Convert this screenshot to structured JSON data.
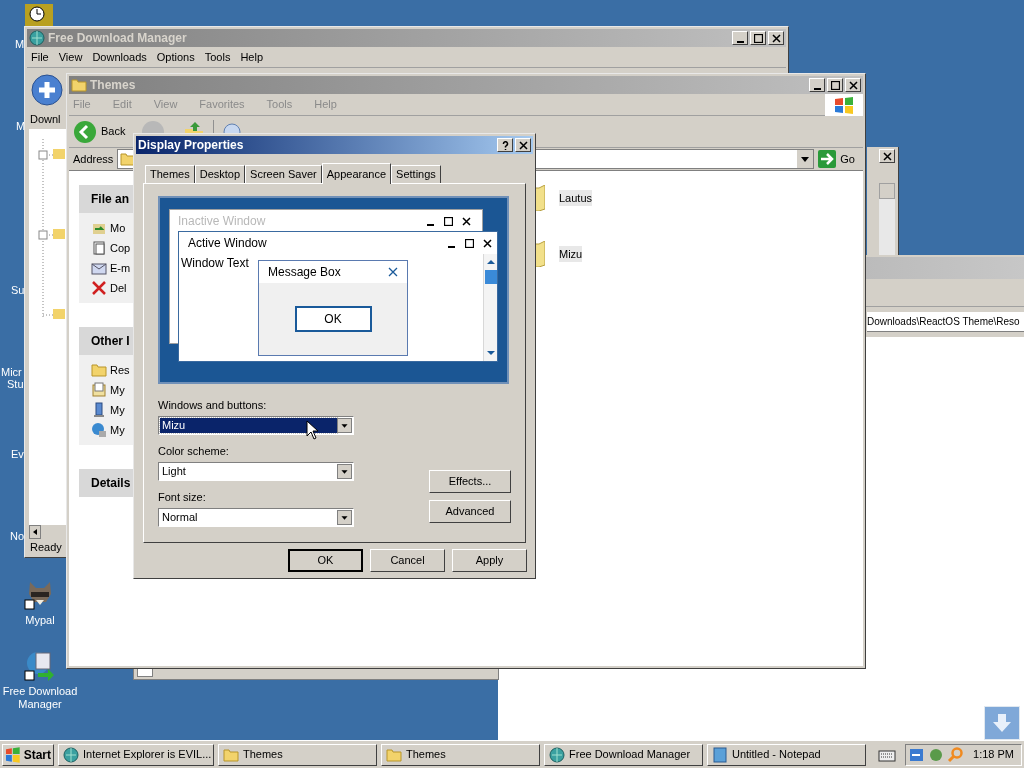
{
  "desktop": {
    "cut_labels": [
      "M",
      "M",
      "Su",
      "Micr",
      "Stu",
      "Ev",
      "No"
    ],
    "icons": [
      {
        "label": "Mypal",
        "kind": "raccoon"
      },
      {
        "label": "Free Download Manager",
        "kind": "download"
      }
    ]
  },
  "fdm_window": {
    "title": "Free Download Manager",
    "menu": [
      "File",
      "View",
      "Downloads",
      "Options",
      "Tools",
      "Help"
    ],
    "tab": "Downl",
    "status": "Ready"
  },
  "themes_window": {
    "title": "Themes",
    "menu": [
      {
        "label": "File",
        "disabled": true
      },
      {
        "label": "Edit",
        "disabled": true
      },
      {
        "label": "View",
        "disabled": true
      },
      {
        "label": "Favorites",
        "disabled": true
      },
      {
        "label": "Tools",
        "disabled": true
      },
      {
        "label": "Help",
        "disabled": true
      }
    ],
    "back": "Back",
    "address_label": "Address",
    "go": "Go",
    "task_sections": [
      {
        "title": "File an",
        "items": [
          {
            "label": "Mo",
            "kind": "move"
          },
          {
            "label": "Cop",
            "kind": "copy"
          },
          {
            "label": "E-m",
            "kind": "mail"
          },
          {
            "label": "Del",
            "kind": "delete"
          }
        ]
      },
      {
        "title": "Other I",
        "items": [
          {
            "label": "Res",
            "kind": "folder"
          },
          {
            "label": "My",
            "kind": "docs"
          },
          {
            "label": "My",
            "kind": "computer"
          },
          {
            "label": "My",
            "kind": "network"
          }
        ]
      },
      {
        "title": "Details"
      }
    ],
    "folders": [
      "Lautus",
      "Mizu"
    ]
  },
  "back_window": {
    "address": "Downloads\\ReactOS Theme\\Reso"
  },
  "dialog": {
    "title": "Display Properties",
    "tabs": [
      {
        "label": "Themes",
        "selected": false
      },
      {
        "label": "Desktop",
        "selected": false
      },
      {
        "label": "Screen Saver",
        "selected": false
      },
      {
        "label": "Appearance",
        "selected": true
      },
      {
        "label": "Settings",
        "selected": false
      }
    ],
    "preview": {
      "inactive_title": "Inactive Window",
      "active_title": "Active Window",
      "window_text": "Window Text",
      "message_title": "Message Box",
      "message_button": "OK"
    },
    "fields": [
      {
        "label": "Windows and buttons:",
        "value": "Mizu",
        "focused": true
      },
      {
        "label": "Color scheme:",
        "value": "Light",
        "focused": false
      },
      {
        "label": "Font size:",
        "value": "Normal",
        "focused": false
      }
    ],
    "side_buttons": [
      "Effects...",
      "Advanced"
    ],
    "buttons": [
      {
        "label": "OK",
        "default": true
      },
      {
        "label": "Cancel",
        "default": false
      },
      {
        "label": "Apply",
        "default": false
      }
    ]
  },
  "taskbar": {
    "start": "Start",
    "tasks": [
      {
        "label": "Internet Explorer is EVIL...",
        "kind": "globe"
      },
      {
        "label": "Themes",
        "kind": "folder"
      },
      {
        "label": "Themes",
        "kind": "folder"
      },
      {
        "label": "Free Download Manager",
        "kind": "fdm"
      },
      {
        "label": "Untitled - Notepad",
        "kind": "notepad"
      }
    ],
    "clock": "1:18 PM"
  }
}
